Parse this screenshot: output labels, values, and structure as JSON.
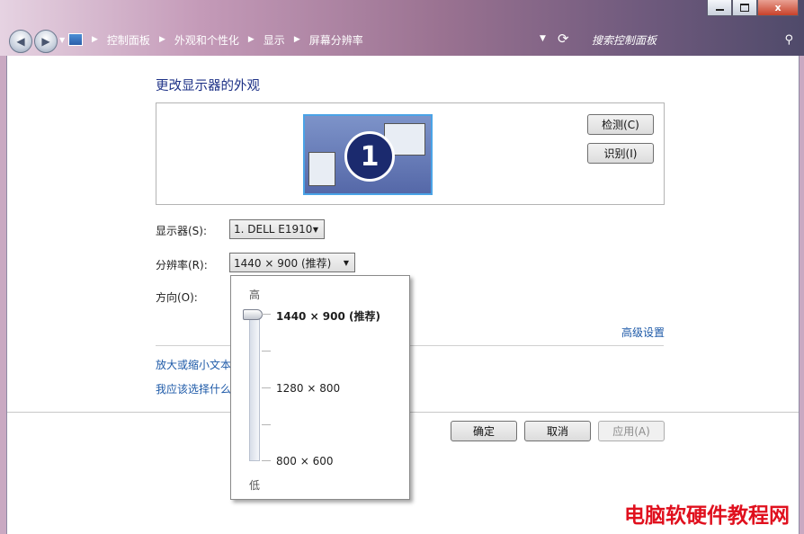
{
  "window": {
    "minimize_label": "",
    "maximize_label": "",
    "close_label": "x"
  },
  "breadcrumbs": [
    "控制面板",
    "外观和个性化",
    "显示",
    "屏幕分辨率"
  ],
  "search": {
    "placeholder": "搜索控制面板"
  },
  "page": {
    "heading": "更改显示器的外观",
    "monitor_number": "1",
    "detect_button": "检测(C)",
    "identify_button": "识别(I)",
    "display_label": "显示器(S):",
    "display_value": "1. DELL E1910",
    "resolution_label": "分辨率(R):",
    "resolution_value": "1440 × 900 (推荐)",
    "orientation_label": "方向(O):",
    "advanced_link": "高级设置",
    "link_text_size": "放大或缩小文本",
    "link_which": "我应该选择什么"
  },
  "dropdown": {
    "high_label": "高",
    "low_label": "低",
    "options": [
      "1440 × 900 (推荐)",
      "1280 × 800",
      "800 × 600"
    ],
    "selected_index": 0
  },
  "footer": {
    "ok_button": "确定",
    "cancel_button": "取消",
    "apply_button": "应用(A)"
  },
  "watermark": "电脑软硬件教程网"
}
